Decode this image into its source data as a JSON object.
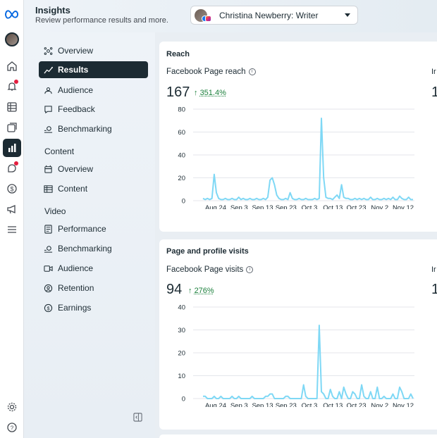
{
  "header": {
    "title": "Insights",
    "subtitle": "Review performance results and more.",
    "account_name": "Christina Newberry: Writer"
  },
  "rail": {
    "icons": [
      "meta-logo",
      "profile-avatar",
      "home-icon",
      "notifications-icon",
      "table-icon",
      "content-icon",
      "insights-icon",
      "messages-icon",
      "monetization-icon",
      "ads-icon",
      "menu-icon",
      "settings-icon",
      "help-icon"
    ],
    "active": "insights-icon"
  },
  "subnav": {
    "items_top": [
      {
        "label": "Overview",
        "icon": "overview-icon"
      },
      {
        "label": "Results",
        "icon": "results-icon",
        "active": true
      },
      {
        "label": "Audience",
        "icon": "audience-icon"
      },
      {
        "label": "Feedback",
        "icon": "feedback-icon"
      },
      {
        "label": "Benchmarking",
        "icon": "benchmarking-icon"
      }
    ],
    "content_section": "Content",
    "items_content": [
      {
        "label": "Overview",
        "icon": "overview-icon"
      },
      {
        "label": "Content",
        "icon": "content-table-icon"
      }
    ],
    "video_section": "Video",
    "items_video": [
      {
        "label": "Performance",
        "icon": "performance-icon"
      },
      {
        "label": "Benchmarking",
        "icon": "benchmarking-icon"
      },
      {
        "label": "Audience",
        "icon": "video-audience-icon"
      },
      {
        "label": "Retention",
        "icon": "retention-icon"
      },
      {
        "label": "Earnings",
        "icon": "earnings-icon"
      }
    ]
  },
  "cards": [
    {
      "title": "Reach",
      "metric_label": "Facebook Page reach",
      "value": "167",
      "change": "351.4%",
      "right_label": "Ir",
      "right_value": "1"
    },
    {
      "title": "Page and profile visits",
      "metric_label": "Facebook Page visits",
      "value": "94",
      "change": "276%",
      "right_label": "Ir",
      "right_value": "1"
    }
  ],
  "chart_data": [
    {
      "type": "line",
      "ylim": [
        0,
        80
      ],
      "yticks": [
        0,
        20,
        40,
        60,
        80
      ],
      "xticks": [
        "Aug 24",
        "Sep 3",
        "Sep 13",
        "Sep 23",
        "Oct 3",
        "Oct 13",
        "Oct 23",
        "Nov 2",
        "Nov 12"
      ],
      "color": "#7fd8f5",
      "series": [
        {
          "values": [
            2,
            1,
            2,
            1,
            2,
            23,
            7,
            2,
            1,
            1,
            2,
            1,
            1,
            2,
            1,
            1,
            3,
            1,
            2,
            1,
            1,
            2,
            1,
            1,
            2,
            1,
            1,
            2,
            1,
            3,
            18,
            20,
            14,
            5,
            2,
            1,
            1,
            2,
            1,
            7,
            2,
            1,
            1,
            2,
            1,
            1,
            2,
            1,
            1,
            1,
            2,
            1,
            2,
            72,
            20,
            3,
            2,
            2,
            1,
            3,
            5,
            2,
            14,
            3,
            2,
            2,
            1,
            1,
            2,
            1,
            2,
            1,
            2,
            1,
            1,
            3,
            1,
            1,
            2,
            1,
            1,
            2,
            1,
            2,
            1,
            3,
            1,
            1,
            4,
            2,
            1,
            1,
            3,
            1,
            1
          ]
        }
      ]
    },
    {
      "type": "line",
      "ylim": [
        0,
        40
      ],
      "yticks": [
        0,
        10,
        20,
        30,
        40
      ],
      "xticks": [
        "Aug 24",
        "Sep 3",
        "Sep 13",
        "Sep 23",
        "Oct 3",
        "Oct 13",
        "Oct 23",
        "Nov 2",
        "Nov 12"
      ],
      "color": "#7fd8f5",
      "series": [
        {
          "values": [
            1,
            1,
            0,
            0,
            0,
            1,
            0,
            0,
            1,
            0,
            0,
            0,
            0,
            1,
            0,
            0,
            1,
            0,
            0,
            0,
            0,
            0,
            1,
            0,
            0,
            0,
            0,
            0,
            1,
            1,
            2,
            2,
            0,
            0,
            0,
            0,
            0,
            1,
            1,
            0,
            0,
            0,
            0,
            0,
            0,
            6,
            1,
            0,
            0,
            0,
            0,
            0,
            32,
            3,
            2,
            0,
            0,
            4,
            1,
            0,
            0,
            3,
            0,
            5,
            2,
            0,
            0,
            3,
            2,
            0,
            0,
            6,
            1,
            0,
            0,
            3,
            0,
            0,
            5,
            0,
            0,
            1,
            0,
            0,
            0,
            2,
            0,
            0,
            5,
            3,
            0,
            0,
            0,
            2,
            0
          ]
        }
      ]
    }
  ]
}
